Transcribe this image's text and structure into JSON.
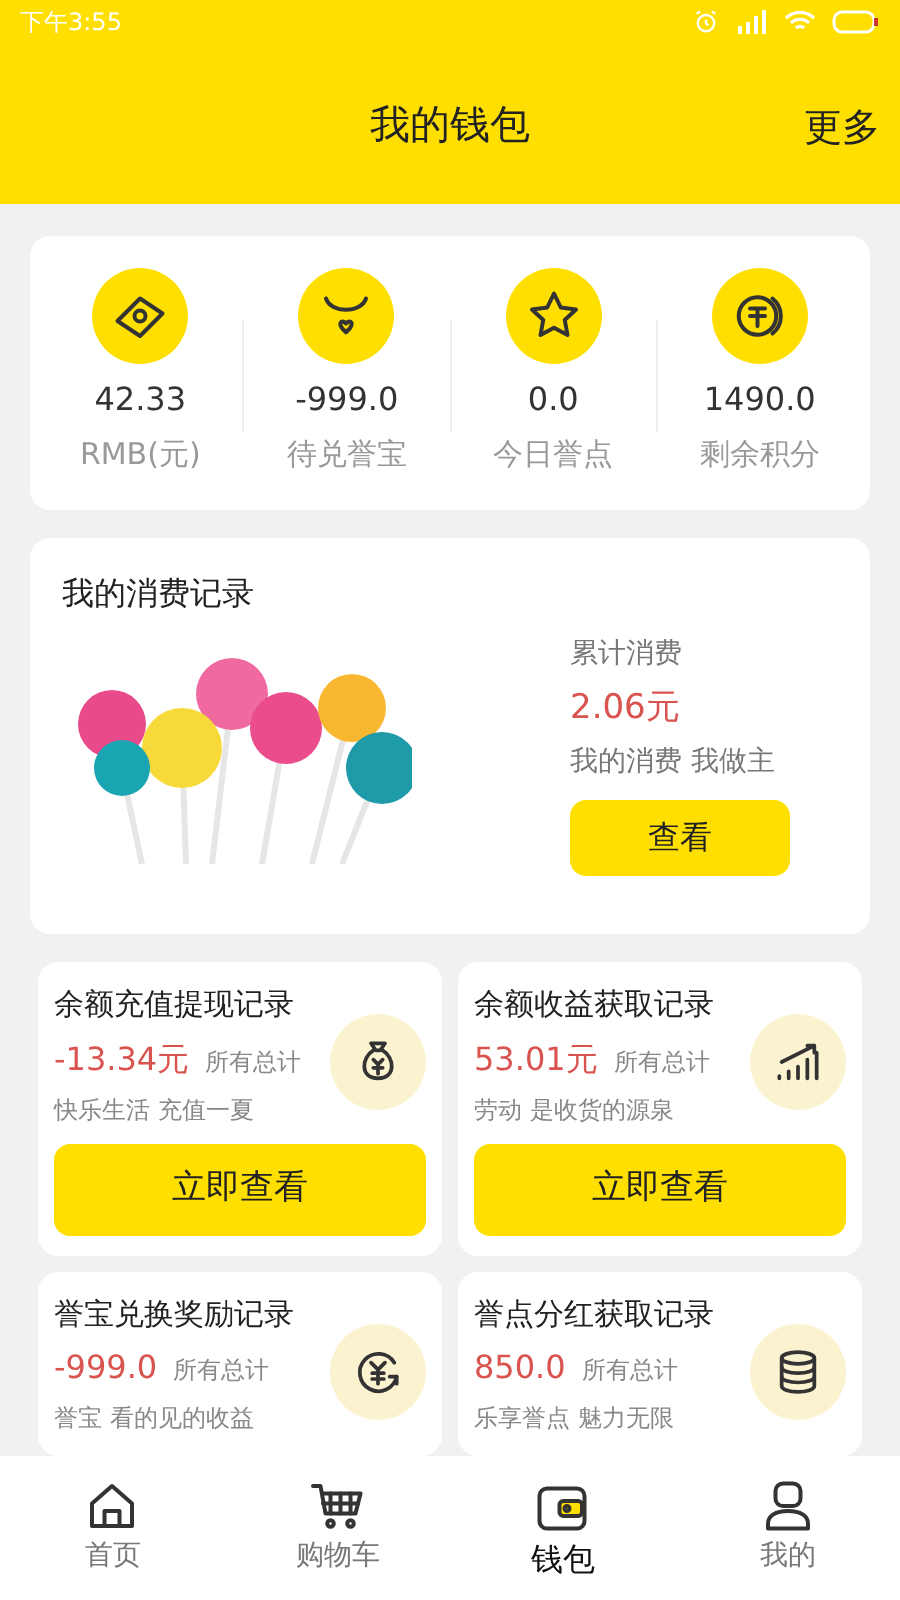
{
  "status_bar": {
    "time": "下午3:55"
  },
  "header": {
    "title": "我的钱包",
    "action": "更多"
  },
  "stats": [
    {
      "value": "42.33",
      "label": "RMB(元)"
    },
    {
      "value": "-999.0",
      "label": "待兑誉宝"
    },
    {
      "value": "0.0",
      "label": "今日誉点"
    },
    {
      "value": "1490.0",
      "label": "剩余积分"
    }
  ],
  "consumption": {
    "title": "我的消费记录",
    "caption": "累计消费",
    "amount": "2.06元",
    "slogan": "我的消费 我做主",
    "button": "查看"
  },
  "records": [
    {
      "title": "余额充值提现记录",
      "amount": "-13.34元",
      "total_label": "所有总计",
      "slogan": "快乐生活 充值一夏",
      "button": "立即查看"
    },
    {
      "title": "余额收益获取记录",
      "amount": "53.01元",
      "total_label": "所有总计",
      "slogan": "劳动 是收货的源泉",
      "button": "立即查看"
    },
    {
      "title": "誉宝兑换奖励记录",
      "amount": "-999.0",
      "total_label": "所有总计",
      "slogan": "誉宝 看的见的收益"
    },
    {
      "title": "誉点分红获取记录",
      "amount": "850.0",
      "total_label": "所有总计",
      "slogan": "乐享誉点 魅力无限"
    }
  ],
  "tabs": [
    {
      "label": "首页",
      "selected": false
    },
    {
      "label": "购物车",
      "selected": false
    },
    {
      "label": "钱包",
      "selected": true
    },
    {
      "label": "我的",
      "selected": false
    }
  ]
}
